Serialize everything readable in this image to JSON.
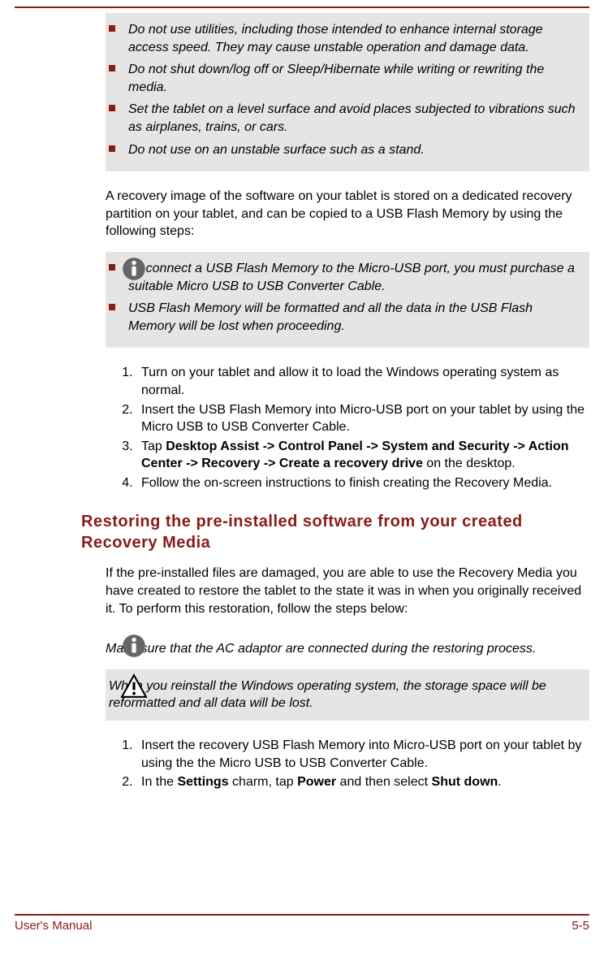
{
  "top_bullets": [
    "Do not use utilities, including those intended to enhance internal storage access speed. They may cause unstable operation and damage data.",
    "Do not shut down/log off or Sleep/Hibernate while writing or rewriting the media.",
    "Set the tablet on a level surface and avoid places subjected to vibrations such as airplanes, trains, or cars.",
    "Do not use on an unstable surface such as a stand."
  ],
  "recovery_intro": "A recovery image of the software on your tablet is stored on a dedicated recovery partition on your tablet, and can be copied to a USB Flash Memory by using the following steps:",
  "info_bullets": [
    "To connect a USB Flash Memory to the Micro-USB port, you must purchase a suitable Micro USB to USB Converter Cable.",
    "USB Flash Memory will be formatted and all the data in the USB Flash Memory will be lost when proceeding."
  ],
  "steps1": {
    "s1": "Turn on your tablet and allow it to load the Windows operating system as normal.",
    "s2": "Insert the USB Flash Memory into Micro-USB port on your tablet by using the Micro USB to USB Converter Cable.",
    "s3_pre": "Tap ",
    "s3_bold": "Desktop Assist -> Control Panel -> System and Security -> Action Center -> Recovery -> Create a recovery drive",
    "s3_post": " on the desktop.",
    "s4": "Follow the on-screen instructions to finish creating the Recovery Media."
  },
  "heading": "Restoring the pre-installed software from your created Recovery Media",
  "restore_intro": "If the pre-installed files are damaged, you are able to use the Recovery Media you have created to restore the tablet to the state it was in when you originally received it. To perform this restoration, follow the steps below:",
  "ac_note": "Make sure that the AC adaptor are connected during the restoring process.",
  "warn_note": "When you reinstall the Windows operating system, the storage space will be reformatted and all data will be lost.",
  "steps2": {
    "s1": "Insert the recovery USB Flash Memory into Micro-USB port on your tablet by using the the Micro USB to USB Converter Cable.",
    "s2_pre": "In the ",
    "s2_b1": "Settings",
    "s2_mid1": " charm, tap ",
    "s2_b2": "Power",
    "s2_mid2": " and then select ",
    "s2_b3": "Shut down",
    "s2_post": "."
  },
  "footer_left": "User's Manual",
  "footer_right": "5-5"
}
